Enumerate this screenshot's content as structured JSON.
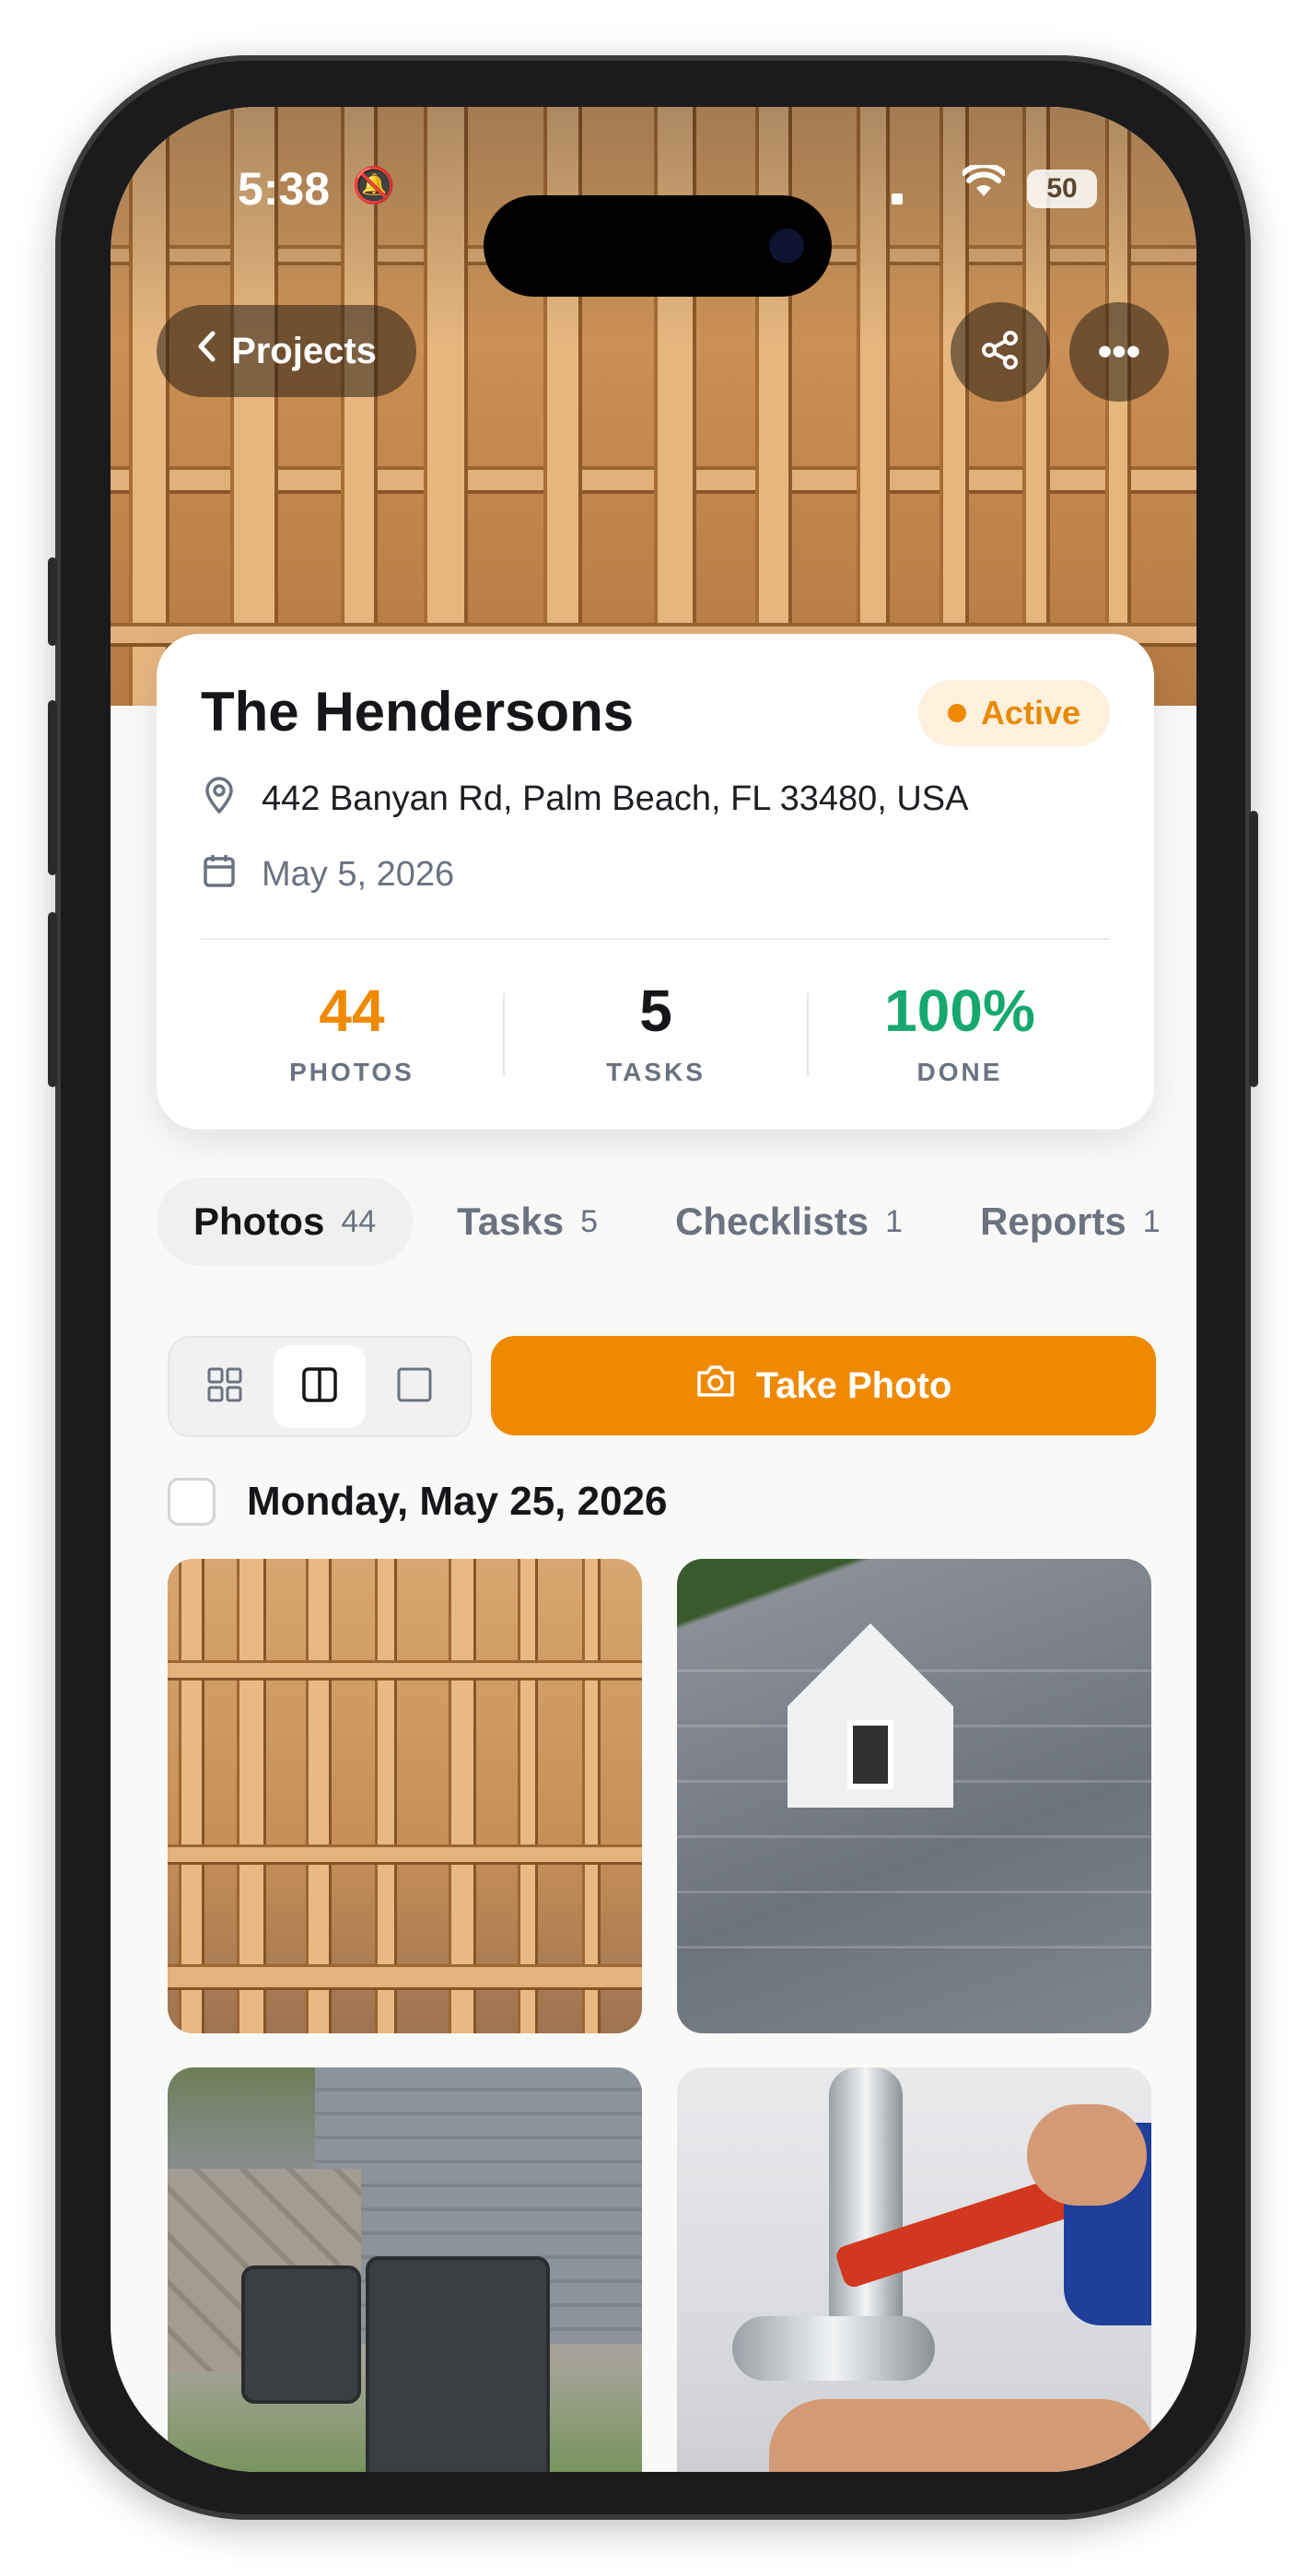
{
  "status_bar": {
    "time": "5:38",
    "battery": "50"
  },
  "nav": {
    "back_label": "Projects"
  },
  "project": {
    "name": "The Hendersons",
    "status": "Active",
    "address": "442 Banyan Rd, Palm Beach, FL 33480, USA",
    "date": "May 5, 2026",
    "stats": [
      {
        "value": "44",
        "label": "PHOTOS",
        "color": "#EF8A00"
      },
      {
        "value": "5",
        "label": "TASKS",
        "color": "#15161A"
      },
      {
        "value": "100%",
        "label": "DONE",
        "color": "#16A86F"
      }
    ]
  },
  "tabs": [
    {
      "label": "Photos",
      "count": "44",
      "active": true
    },
    {
      "label": "Tasks",
      "count": "5"
    },
    {
      "label": "Checklists",
      "count": "1"
    },
    {
      "label": "Reports",
      "count": "1"
    }
  ],
  "toolbar": {
    "take_photo_label": "Take Photo",
    "view_modes": [
      "grid-view-icon",
      "split-view-icon",
      "single-view-icon"
    ],
    "selected_view": "split-view-icon"
  },
  "photo_group": {
    "date_label": "Monday, May 25, 2026"
  },
  "photos": [
    {
      "icon": "framing-photo"
    },
    {
      "icon": "roof-photo"
    },
    {
      "icon": "ac-units-photo"
    },
    {
      "icon": "plumbing-photo"
    }
  ],
  "colors": {
    "accent": "#EF8A00",
    "success": "#16A86F",
    "badge_bg": "#FDF0DD"
  }
}
